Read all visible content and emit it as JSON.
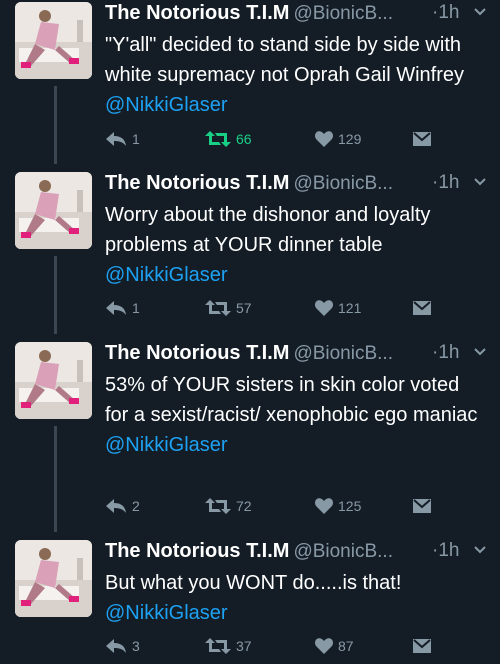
{
  "colors": {
    "background": "#141d26",
    "mention": "#1da1f2",
    "muted": "#8899a6",
    "retweet_active": "#19cf86"
  },
  "tweets": [
    {
      "name": "The Notorious T.I.M",
      "handle": "@BionicB...",
      "time": "·1h",
      "text": "\"Y'all\" decided to stand side by side with white supremacy not Oprah Gail Winfrey",
      "mention": "@NikkiGlaser",
      "replies": "1",
      "retweets": "66",
      "likes": "129",
      "retweeted": true
    },
    {
      "name": "The Notorious T.I.M",
      "handle": "@BionicB...",
      "time": "·1h",
      "text": "Worry about the dishonor and loyalty problems at YOUR dinner table",
      "mention": "@NikkiGlaser",
      "replies": "1",
      "retweets": "57",
      "likes": "121",
      "retweeted": false
    },
    {
      "name": "The Notorious T.I.M",
      "handle": "@BionicB...",
      "time": "·1h",
      "text": "53% of YOUR sisters in skin color voted for a sexist/racist/ xenophobic ego maniac",
      "mention": "@NikkiGlaser",
      "replies": "2",
      "retweets": "72",
      "likes": "125",
      "retweeted": false
    },
    {
      "name": "The Notorious T.I.M",
      "handle": "@BionicB...",
      "time": "·1h",
      "text": "But what you WONT do.....is that!",
      "mention": "@NikkiGlaser",
      "replies": "3",
      "retweets": "37",
      "likes": "87",
      "retweeted": false
    }
  ]
}
